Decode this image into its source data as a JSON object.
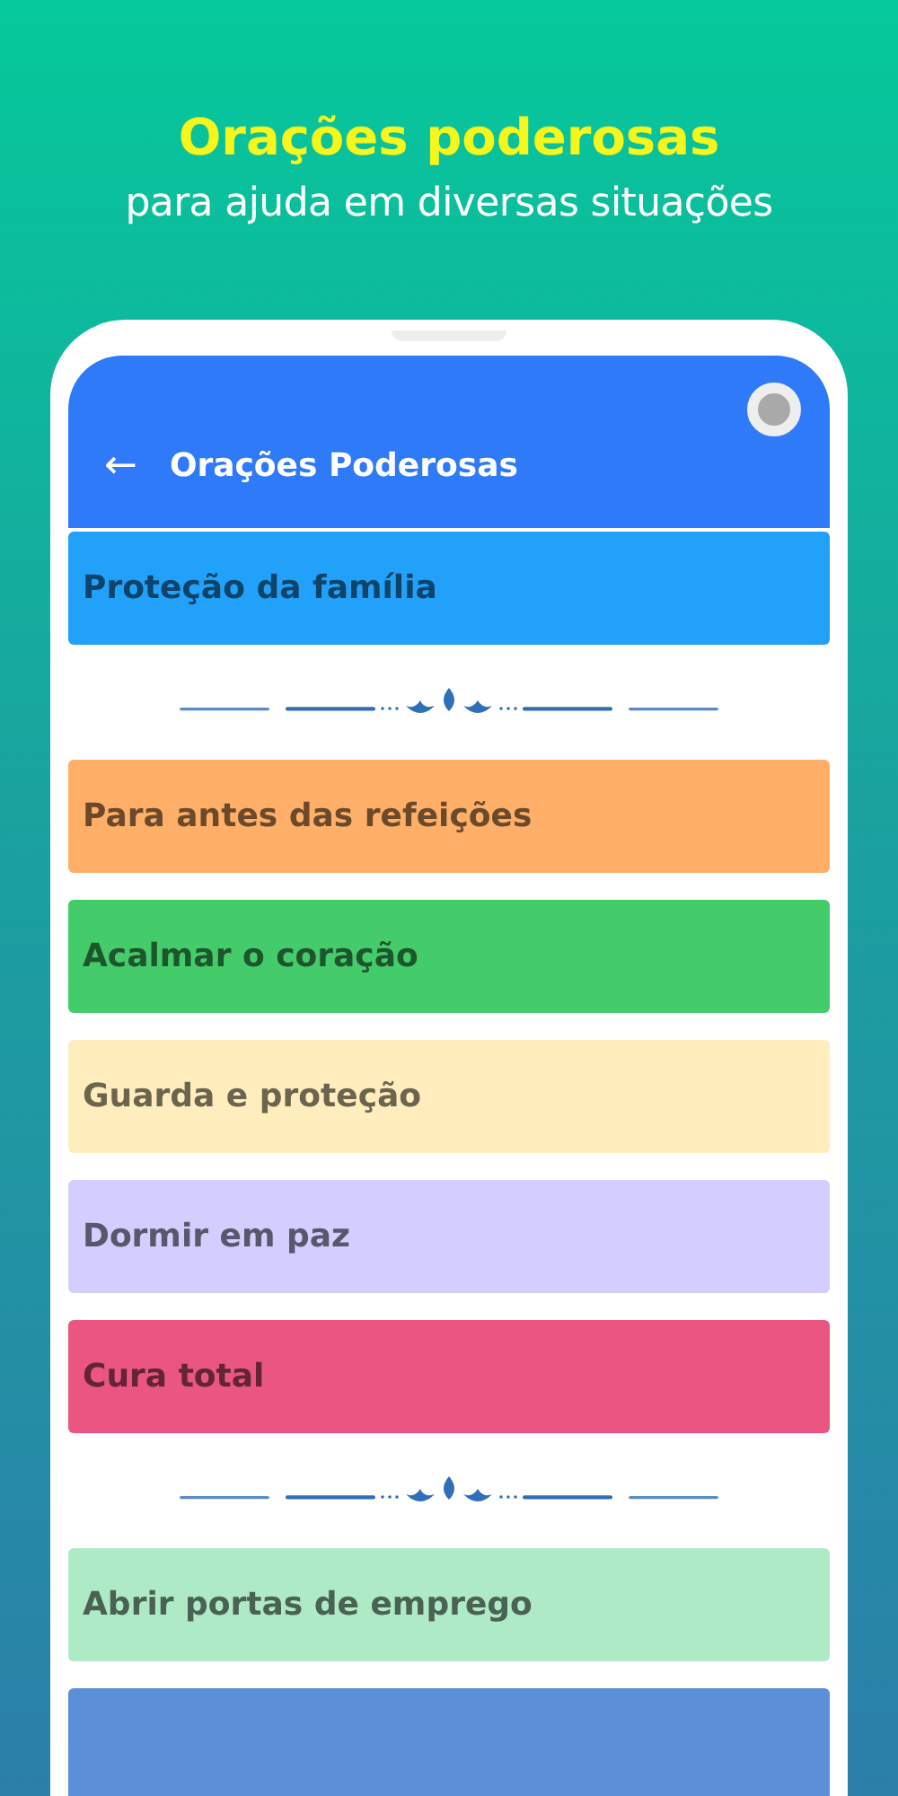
{
  "headline": {
    "title": "Orações poderosas",
    "subtitle": "para ajuda em diversas situações"
  },
  "app_bar": {
    "back": "←",
    "title": "Orações Poderosas"
  },
  "list": [
    {
      "kind": "prayer",
      "label": "Proteção da família",
      "color": "#22a1fb"
    },
    {
      "kind": "divider"
    },
    {
      "kind": "prayer",
      "label": "Para antes das refeições",
      "color": "#ffaf68"
    },
    {
      "kind": "prayer",
      "label": "Acalmar o coração",
      "color": "#45cc6a"
    },
    {
      "kind": "prayer",
      "label": "Guarda e proteção",
      "color": "#ffedbd"
    },
    {
      "kind": "prayer",
      "label": "Dormir em paz",
      "color": "#d2ceff"
    },
    {
      "kind": "prayer",
      "label": "Cura total",
      "color": "#ea5681"
    },
    {
      "kind": "divider"
    },
    {
      "kind": "prayer",
      "label": "Abrir portas de emprego",
      "color": "#aeeac5"
    },
    {
      "kind": "prayer",
      "color": "#5b8fd8"
    }
  ]
}
